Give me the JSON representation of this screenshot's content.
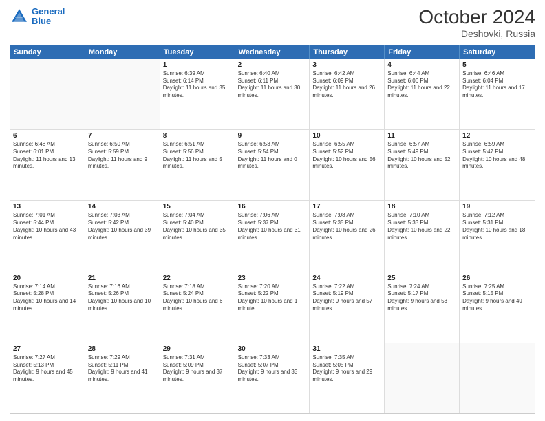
{
  "header": {
    "logo_line1": "General",
    "logo_line2": "Blue",
    "month": "October 2024",
    "location": "Deshovki, Russia"
  },
  "weekdays": [
    "Sunday",
    "Monday",
    "Tuesday",
    "Wednesday",
    "Thursday",
    "Friday",
    "Saturday"
  ],
  "rows": [
    [
      {
        "day": "",
        "text": "",
        "empty": true
      },
      {
        "day": "",
        "text": "",
        "empty": true
      },
      {
        "day": "1",
        "text": "Sunrise: 6:39 AM\nSunset: 6:14 PM\nDaylight: 11 hours and 35 minutes."
      },
      {
        "day": "2",
        "text": "Sunrise: 6:40 AM\nSunset: 6:11 PM\nDaylight: 11 hours and 30 minutes."
      },
      {
        "day": "3",
        "text": "Sunrise: 6:42 AM\nSunset: 6:09 PM\nDaylight: 11 hours and 26 minutes."
      },
      {
        "day": "4",
        "text": "Sunrise: 6:44 AM\nSunset: 6:06 PM\nDaylight: 11 hours and 22 minutes."
      },
      {
        "day": "5",
        "text": "Sunrise: 6:46 AM\nSunset: 6:04 PM\nDaylight: 11 hours and 17 minutes."
      }
    ],
    [
      {
        "day": "6",
        "text": "Sunrise: 6:48 AM\nSunset: 6:01 PM\nDaylight: 11 hours and 13 minutes."
      },
      {
        "day": "7",
        "text": "Sunrise: 6:50 AM\nSunset: 5:59 PM\nDaylight: 11 hours and 9 minutes."
      },
      {
        "day": "8",
        "text": "Sunrise: 6:51 AM\nSunset: 5:56 PM\nDaylight: 11 hours and 5 minutes."
      },
      {
        "day": "9",
        "text": "Sunrise: 6:53 AM\nSunset: 5:54 PM\nDaylight: 11 hours and 0 minutes."
      },
      {
        "day": "10",
        "text": "Sunrise: 6:55 AM\nSunset: 5:52 PM\nDaylight: 10 hours and 56 minutes."
      },
      {
        "day": "11",
        "text": "Sunrise: 6:57 AM\nSunset: 5:49 PM\nDaylight: 10 hours and 52 minutes."
      },
      {
        "day": "12",
        "text": "Sunrise: 6:59 AM\nSunset: 5:47 PM\nDaylight: 10 hours and 48 minutes."
      }
    ],
    [
      {
        "day": "13",
        "text": "Sunrise: 7:01 AM\nSunset: 5:44 PM\nDaylight: 10 hours and 43 minutes."
      },
      {
        "day": "14",
        "text": "Sunrise: 7:03 AM\nSunset: 5:42 PM\nDaylight: 10 hours and 39 minutes."
      },
      {
        "day": "15",
        "text": "Sunrise: 7:04 AM\nSunset: 5:40 PM\nDaylight: 10 hours and 35 minutes."
      },
      {
        "day": "16",
        "text": "Sunrise: 7:06 AM\nSunset: 5:37 PM\nDaylight: 10 hours and 31 minutes."
      },
      {
        "day": "17",
        "text": "Sunrise: 7:08 AM\nSunset: 5:35 PM\nDaylight: 10 hours and 26 minutes."
      },
      {
        "day": "18",
        "text": "Sunrise: 7:10 AM\nSunset: 5:33 PM\nDaylight: 10 hours and 22 minutes."
      },
      {
        "day": "19",
        "text": "Sunrise: 7:12 AM\nSunset: 5:31 PM\nDaylight: 10 hours and 18 minutes."
      }
    ],
    [
      {
        "day": "20",
        "text": "Sunrise: 7:14 AM\nSunset: 5:28 PM\nDaylight: 10 hours and 14 minutes."
      },
      {
        "day": "21",
        "text": "Sunrise: 7:16 AM\nSunset: 5:26 PM\nDaylight: 10 hours and 10 minutes."
      },
      {
        "day": "22",
        "text": "Sunrise: 7:18 AM\nSunset: 5:24 PM\nDaylight: 10 hours and 6 minutes."
      },
      {
        "day": "23",
        "text": "Sunrise: 7:20 AM\nSunset: 5:22 PM\nDaylight: 10 hours and 1 minute."
      },
      {
        "day": "24",
        "text": "Sunrise: 7:22 AM\nSunset: 5:19 PM\nDaylight: 9 hours and 57 minutes."
      },
      {
        "day": "25",
        "text": "Sunrise: 7:24 AM\nSunset: 5:17 PM\nDaylight: 9 hours and 53 minutes."
      },
      {
        "day": "26",
        "text": "Sunrise: 7:25 AM\nSunset: 5:15 PM\nDaylight: 9 hours and 49 minutes."
      }
    ],
    [
      {
        "day": "27",
        "text": "Sunrise: 7:27 AM\nSunset: 5:13 PM\nDaylight: 9 hours and 45 minutes."
      },
      {
        "day": "28",
        "text": "Sunrise: 7:29 AM\nSunset: 5:11 PM\nDaylight: 9 hours and 41 minutes."
      },
      {
        "day": "29",
        "text": "Sunrise: 7:31 AM\nSunset: 5:09 PM\nDaylight: 9 hours and 37 minutes."
      },
      {
        "day": "30",
        "text": "Sunrise: 7:33 AM\nSunset: 5:07 PM\nDaylight: 9 hours and 33 minutes."
      },
      {
        "day": "31",
        "text": "Sunrise: 7:35 AM\nSunset: 5:05 PM\nDaylight: 9 hours and 29 minutes."
      },
      {
        "day": "",
        "text": "",
        "empty": true
      },
      {
        "day": "",
        "text": "",
        "empty": true
      }
    ]
  ]
}
